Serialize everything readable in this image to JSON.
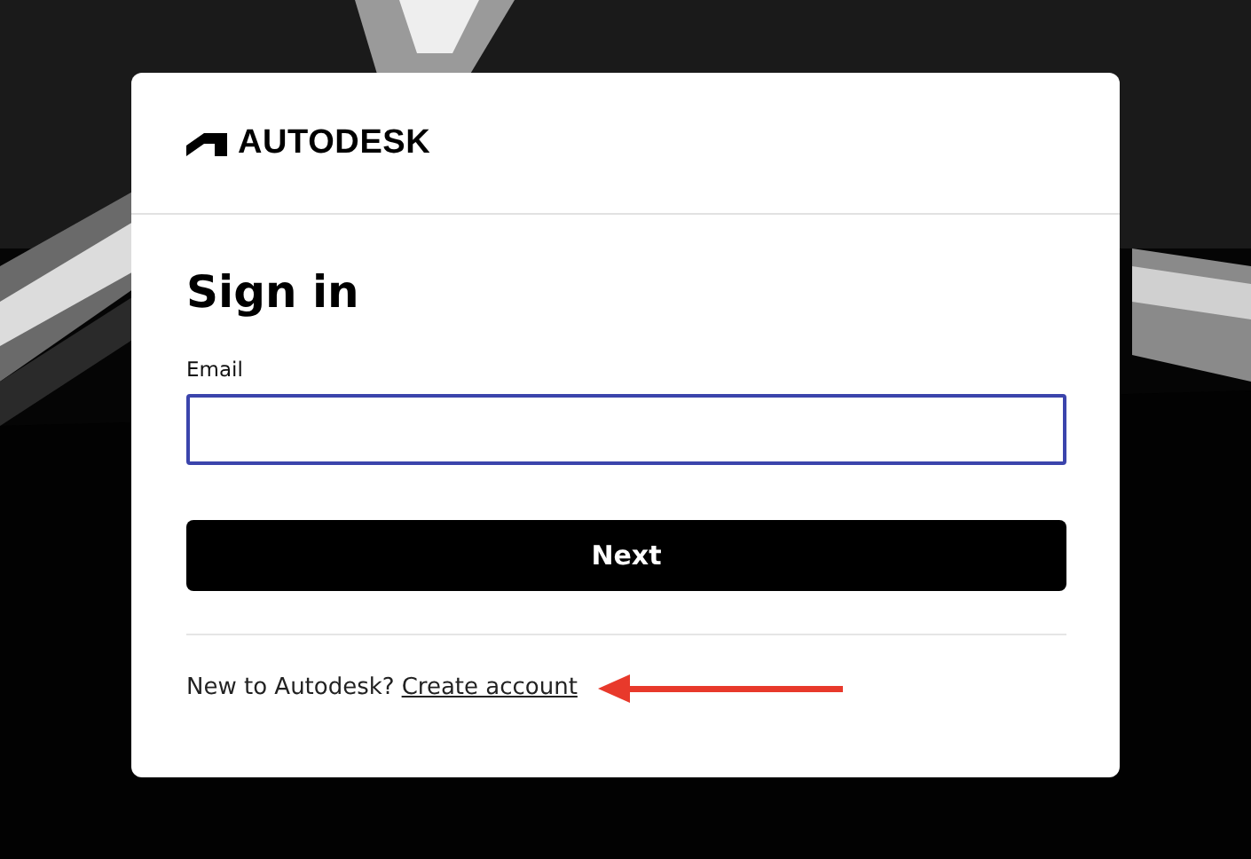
{
  "logo": {
    "wordmark": "AUTODESK"
  },
  "heading": "Sign in",
  "email": {
    "label": "Email",
    "focused": true
  },
  "next_button": {
    "label": "Next"
  },
  "footer": {
    "prompt": "New to Autodesk?",
    "link": "Create account"
  }
}
